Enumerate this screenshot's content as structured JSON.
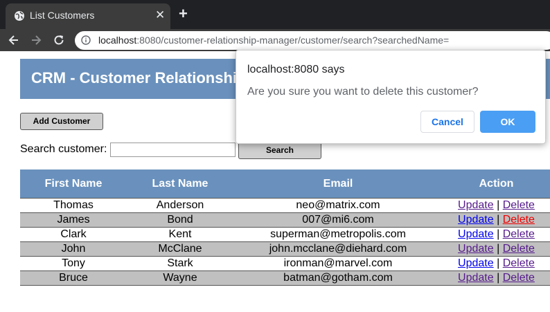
{
  "browser": {
    "tab_title": "List Customers",
    "tab_close": "✕",
    "new_tab": "+",
    "url_host": "localhost",
    "url_rest": ":8080/customer-relationship-manager/customer/search?searchedName="
  },
  "page": {
    "title": "CRM - Customer Relationship Manager",
    "add_button": "Add Customer",
    "search_label": "Search customer:",
    "search_value": "",
    "search_button": "Search",
    "columns": [
      "First Name",
      "Last Name",
      "Email",
      "Action"
    ],
    "update_label": "Update",
    "delete_label": "Delete",
    "separator": "|",
    "customers": [
      {
        "first": "Thomas",
        "last": "Anderson",
        "email": "neo@matrix.com"
      },
      {
        "first": "James",
        "last": "Bond",
        "email": "007@mi6.com"
      },
      {
        "first": "Clark",
        "last": "Kent",
        "email": "superman@metropolis.com"
      },
      {
        "first": "John",
        "last": "McClane",
        "email": "john.mcclane@diehard.com"
      },
      {
        "first": "Tony",
        "last": "Stark",
        "email": "ironman@marvel.com"
      },
      {
        "first": "Bruce",
        "last": "Wayne",
        "email": "batman@gotham.com"
      }
    ]
  },
  "dialog": {
    "title": "localhost:8080 says",
    "message": "Are you sure you want to delete this customer?",
    "cancel": "Cancel",
    "ok": "OK"
  },
  "colors": {
    "header_band": "#6a91bd",
    "ok_button": "#4a9ef3",
    "chrome_dark": "#202124"
  }
}
